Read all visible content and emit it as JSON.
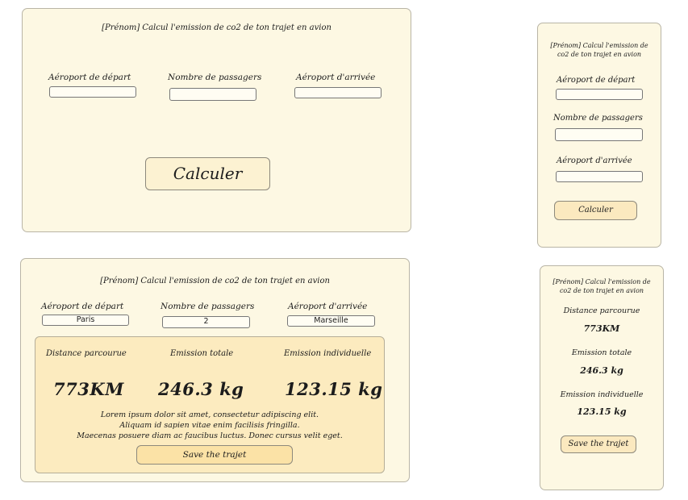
{
  "desktop_form": {
    "title": "[Prénom] Calcul l'emission de co2 de ton trajet en avion",
    "departure_label": "Aéroport de départ",
    "passengers_label": "Nombre de passagers",
    "arrival_label": "Aéroport d'arrivée",
    "calculate_label": "Calculer"
  },
  "mobile_form": {
    "title_line1": "[Prénom] Calcul l'emission de",
    "title_line2": "co2 de ton trajet en avion",
    "departure_label": "Aéroport de départ",
    "passengers_label": "Nombre de passagers",
    "arrival_label": "Aéroport d'arrivée",
    "calculate_label": "Calculer"
  },
  "desktop_result": {
    "title": "[Prénom] Calcul l'emission de co2 de ton trajet en avion",
    "departure_label": "Aéroport de départ",
    "departure_value": "Paris",
    "passengers_label": "Nombre de passagers",
    "passengers_value": "2",
    "arrival_label": "Aéroport d'arrivée",
    "arrival_value": "Marseille",
    "distance_label": "Distance parcourue",
    "distance_value": "773KM",
    "total_label": "Emission totale",
    "total_value": "246.3 kg",
    "individual_label": "Emission individuelle",
    "individual_value": "123.15 kg",
    "lorem_line1": "Lorem ipsum dolor sit amet, consectetur adipiscing elit.",
    "lorem_line2": "Aliquam id sapien vitae enim facilisis fringilla.",
    "lorem_line3": "Maecenas posuere diam ac faucibus luctus. Donec cursus velit eget.",
    "save_label": "Save the trajet"
  },
  "mobile_result": {
    "title_line1": "[Prénom] Calcul l'emission de",
    "title_line2": "co2 de ton trajet en avion",
    "distance_label": "Distance parcourue",
    "distance_value": "773KM",
    "total_label": "Emission totale",
    "total_value": "246.3 kg",
    "individual_label": "Emission individuelle",
    "individual_value": "123.15 kg",
    "save_label": "Save the trajet"
  }
}
